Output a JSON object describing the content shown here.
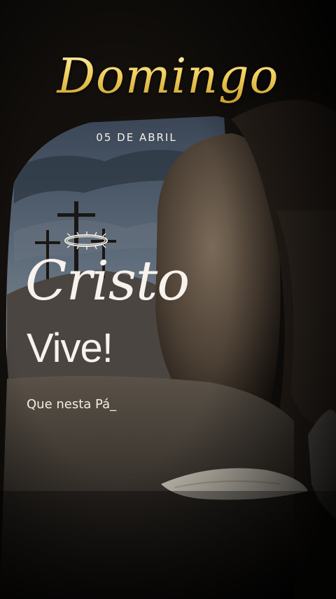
{
  "header": {
    "title": "Domingo",
    "date": "05 DE ABRIL"
  },
  "headline": {
    "line1": "Cristo",
    "line2": "Vive!"
  },
  "subtitle": "Que nesta Pá_",
  "colors": {
    "gold": "#e8c350",
    "text": "#f7f3ec",
    "background": "#0c0a09"
  },
  "icons": {
    "crown": "crown-of-thorns-icon"
  }
}
